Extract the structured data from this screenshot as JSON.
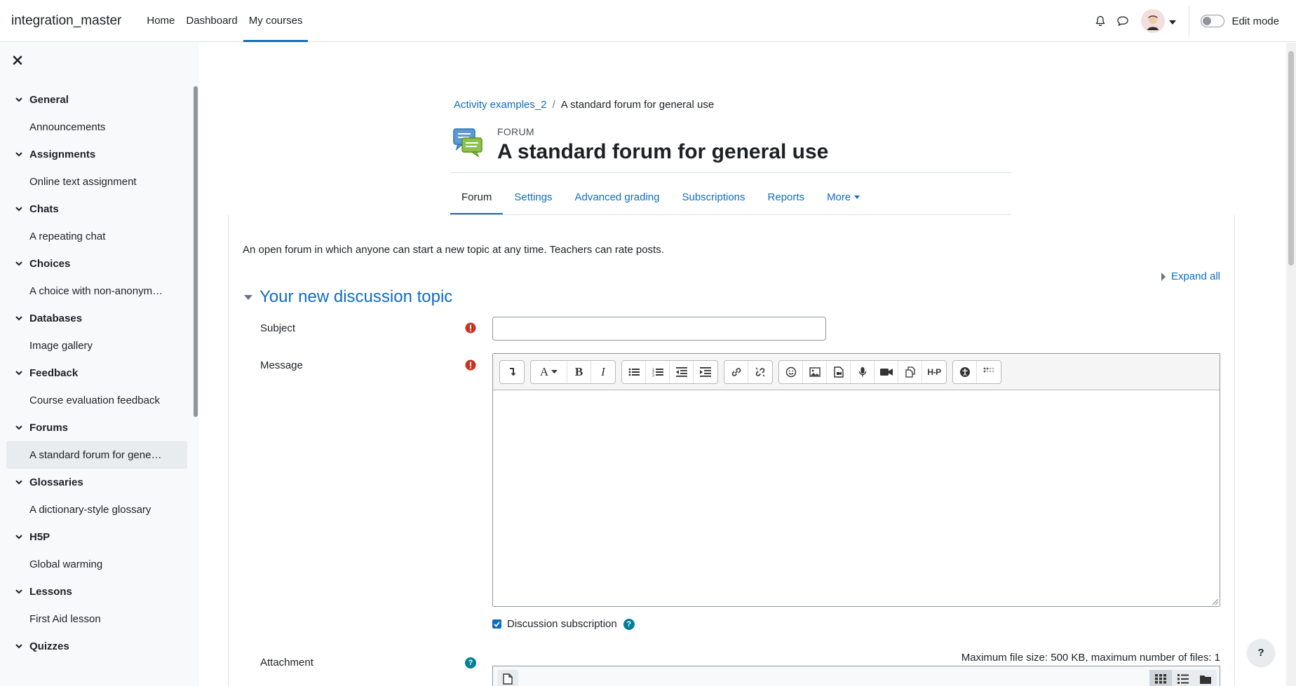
{
  "navbar": {
    "brand": "integration_master",
    "links": [
      {
        "label": "Home"
      },
      {
        "label": "Dashboard"
      },
      {
        "label": "My courses"
      }
    ],
    "edit_mode_label": "Edit mode",
    "icons": [
      "bell-icon",
      "chat-icon",
      "avatar",
      "chevron-down-icon"
    ]
  },
  "drawer": {
    "sections": [
      {
        "title": "General",
        "item": "Announcements"
      },
      {
        "title": "Assignments",
        "item": "Online text assignment"
      },
      {
        "title": "Chats",
        "item": "A repeating chat"
      },
      {
        "title": "Choices",
        "item": "A choice with non-anonym…"
      },
      {
        "title": "Databases",
        "item": "Image gallery"
      },
      {
        "title": "Feedback",
        "item": "Course evaluation feedback"
      },
      {
        "title": "Forums",
        "item": "A standard forum for gene…"
      },
      {
        "title": "Glossaries",
        "item": "A dictionary-style glossary"
      },
      {
        "title": "H5P",
        "item": "Global warming"
      },
      {
        "title": "Lessons",
        "item": "First Aid lesson"
      },
      {
        "title": "Quizzes",
        "item": ""
      }
    ]
  },
  "breadcrumb": {
    "course": "Activity examples_2",
    "separator": "/",
    "current": "A standard forum for general use"
  },
  "header": {
    "modtype": "FORUM",
    "title": "A standard forum for general use"
  },
  "tabs": [
    {
      "label": "Forum"
    },
    {
      "label": "Settings"
    },
    {
      "label": "Advanced grading"
    },
    {
      "label": "Subscriptions"
    },
    {
      "label": "Reports"
    },
    {
      "label": "More"
    }
  ],
  "intro": "An open forum in which anyone can start a new topic at any time. Teachers can rate posts.",
  "expand_all": "Expand all",
  "form": {
    "legend": "Your new discussion topic",
    "subject_label": "Subject",
    "subject_value": "",
    "message_label": "Message",
    "subscription_label": "Discussion subscription",
    "attachment_label": "Attachment",
    "max_file": "Maximum file size: 500 KB, maximum number of files: 1"
  },
  "colors": {
    "accent": "#0f6cbf",
    "help": "#008196",
    "required": "#ca3120"
  }
}
